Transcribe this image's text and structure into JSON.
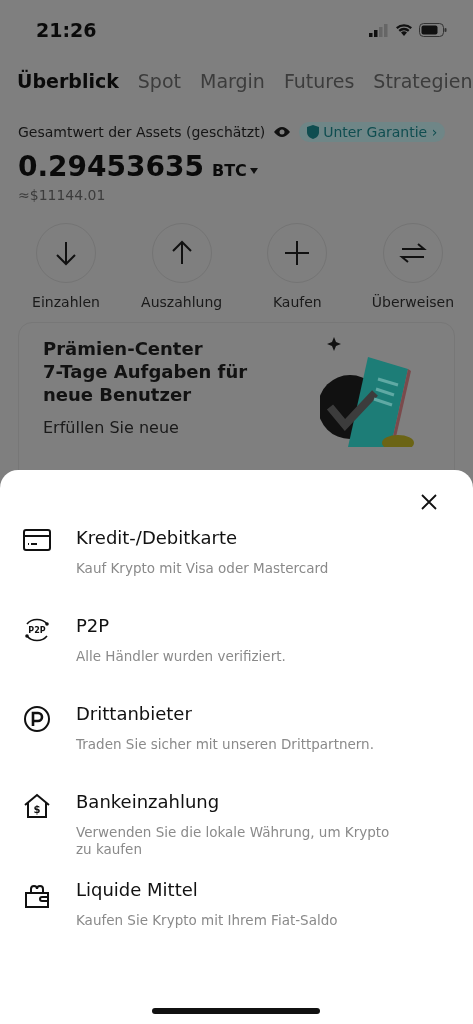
{
  "status_bar": {
    "time": "21:26"
  },
  "tabs": [
    {
      "label": "Überblick",
      "selected": true
    },
    {
      "label": "Spot",
      "selected": false
    },
    {
      "label": "Margin",
      "selected": false
    },
    {
      "label": "Futures",
      "selected": false
    },
    {
      "label": "Strategien",
      "selected": false
    }
  ],
  "assets": {
    "label": "Gesamtwert der Assets (geschätzt)",
    "guarantee": "Unter Garantie",
    "guarantee_chevron": "›",
    "amount": "0.29453635",
    "currency": "BTC",
    "fiat": "≈$11144.01"
  },
  "actions": [
    {
      "kind": "down",
      "label": "Einzahlen"
    },
    {
      "kind": "up",
      "label": "Auszahlung"
    },
    {
      "kind": "plus",
      "label": "Kaufen"
    },
    {
      "kind": "swap",
      "label": "Überweisen"
    }
  ],
  "promo": {
    "title": "Prämien-Center\n7-Tage Aufgaben für\nneue Benutzer",
    "text": "Erfüllen Sie neue"
  },
  "sheet": {
    "options": [
      {
        "kind": "card",
        "title": "Kredit-/Debitkarte",
        "subtitle": "Kauf Krypto mit Visa oder Mastercard"
      },
      {
        "kind": "p2p",
        "icon_text": "P2P",
        "title": "P2P",
        "subtitle": "Alle Händler wurden verifiziert."
      },
      {
        "kind": "third",
        "title": "Drittanbieter",
        "subtitle": "Traden Sie sicher mit unseren Drittpartnern."
      },
      {
        "kind": "bank",
        "icon_text": "$",
        "title": "Bankeinzahlung",
        "subtitle": "Verwenden Sie die lokale Währung, um Krypto zu kaufen"
      },
      {
        "kind": "wallet",
        "title": "Liquide Mittel",
        "subtitle": "Kaufen Sie Krypto mit Ihrem Fiat-Saldo"
      }
    ]
  }
}
